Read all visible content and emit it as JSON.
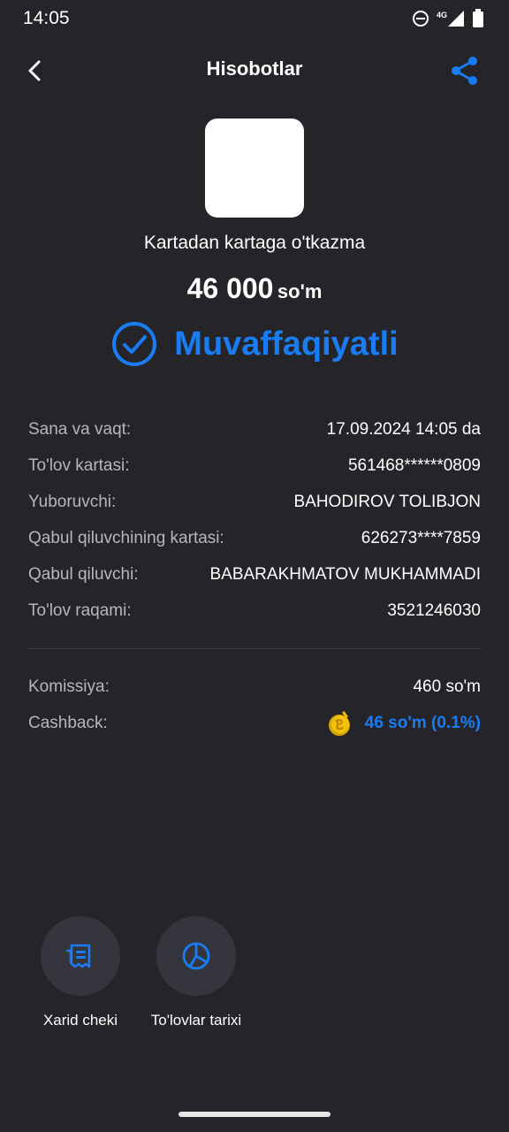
{
  "status_bar": {
    "time": "14:05",
    "network": "4G",
    "icons": [
      "do-not-disturb-icon",
      "signal-icon",
      "battery-icon"
    ]
  },
  "header": {
    "title": "Hisobotlar",
    "back_icon": "chevron-left-icon",
    "share_icon": "share-icon"
  },
  "transaction": {
    "type": "Kartadan kartaga o'tkazma",
    "amount": "46 000",
    "currency": "so'm",
    "status": "Muvaffaqiyatli",
    "status_icon": "check-circle-icon"
  },
  "details": [
    {
      "label": "Sana va vaqt:",
      "value": "17.09.2024 14:05 da"
    },
    {
      "label": "To'lov kartasi:",
      "value": "561468******0809"
    },
    {
      "label": "Yuboruvchi:",
      "value": "BAHODIROV TOLIBJON"
    },
    {
      "label": "Qabul qiluvchining kartasi:",
      "value": "626273****7859"
    },
    {
      "label": "Qabul qiluvchi:",
      "value": "BABARAKHMATOV MUKHAMMADI"
    },
    {
      "label": "To'lov raqami:",
      "value": "3521246030"
    }
  ],
  "fees": {
    "commission_label": "Komissiya:",
    "commission_value": "460 so'm",
    "cashback_label": "Cashback:",
    "cashback_value": "46 so'm (0.1%)",
    "cashback_icon": "coin-icon"
  },
  "actions": [
    {
      "label": "Xarid cheki",
      "icon": "receipt-icon"
    },
    {
      "label": "To'lovlar tarixi",
      "icon": "pie-chart-icon"
    }
  ],
  "colors": {
    "background": "#242429",
    "accent": "#1a7cf2",
    "label": "#b6b7bc",
    "button_bg": "#34353d"
  }
}
